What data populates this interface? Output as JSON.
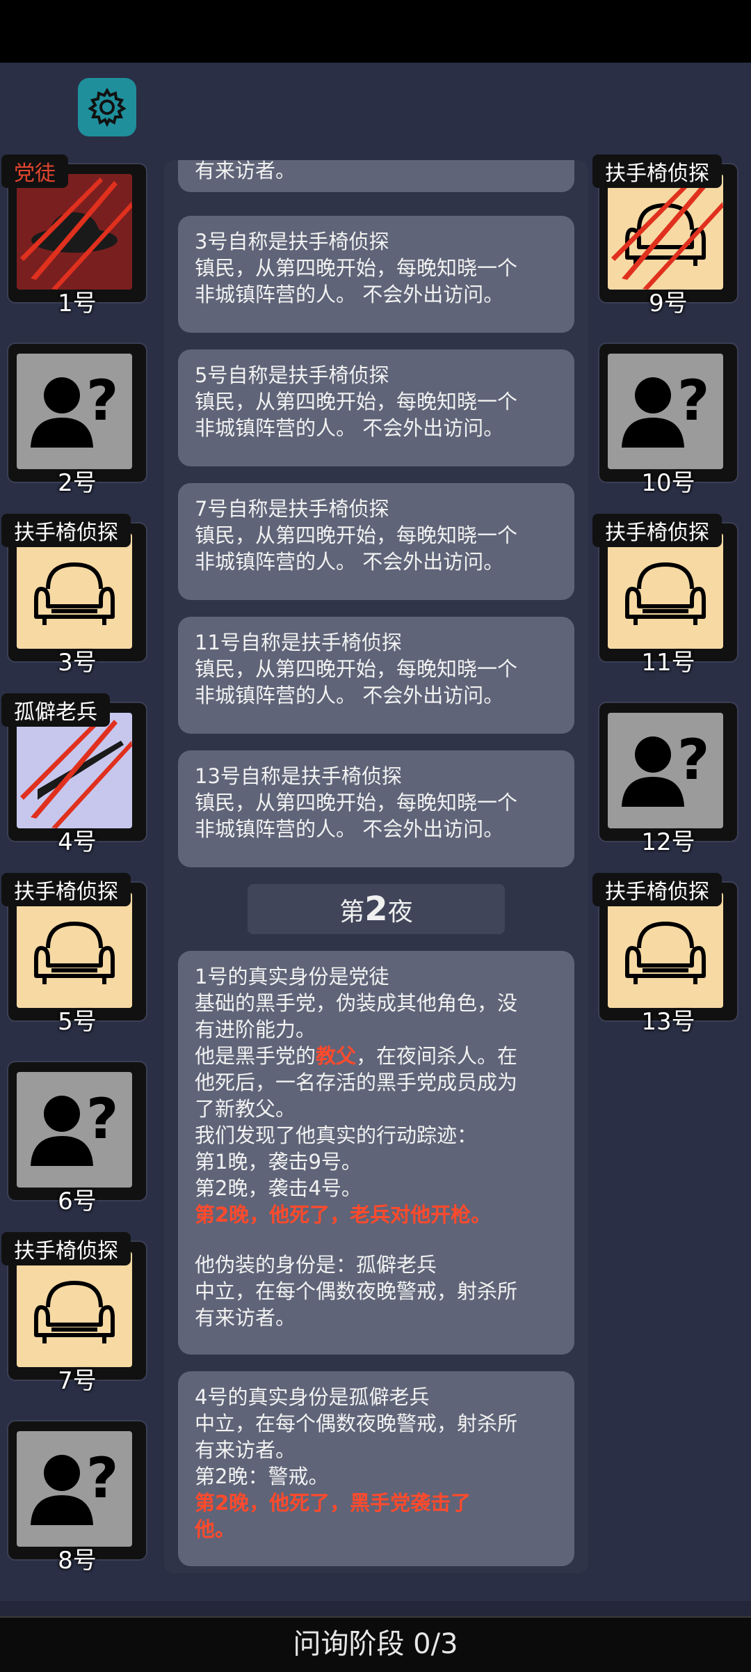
{
  "settings_icon": "gear-icon",
  "players_left": [
    {
      "number": "1号",
      "role": "党徒",
      "role_color": "red",
      "portrait": "mafia"
    },
    {
      "number": "2号",
      "role": "",
      "portrait": "unknown"
    },
    {
      "number": "3号",
      "role": "扶手椅侦探",
      "portrait": "detective"
    },
    {
      "number": "4号",
      "role": "孤僻老兵",
      "portrait": "veteran"
    },
    {
      "number": "5号",
      "role": "扶手椅侦探",
      "portrait": "detective"
    },
    {
      "number": "6号",
      "role": "",
      "portrait": "unknown"
    },
    {
      "number": "7号",
      "role": "扶手椅侦探",
      "portrait": "detective"
    },
    {
      "number": "8号",
      "role": "",
      "portrait": "unknown"
    }
  ],
  "players_right": [
    {
      "number": "9号",
      "role": "扶手椅侦探",
      "portrait": "detective-dead"
    },
    {
      "number": "10号",
      "role": "",
      "portrait": "unknown"
    },
    {
      "number": "11号",
      "role": "扶手椅侦探",
      "portrait": "detective"
    },
    {
      "number": "12号",
      "role": "",
      "portrait": "unknown"
    },
    {
      "number": "13号",
      "role": "扶手椅侦探",
      "portrait": "detective"
    }
  ],
  "log": {
    "top_partial": "有来访者。",
    "claims": [
      {
        "title": "3号自称是扶手椅侦探",
        "desc1": "镇民，从第四晚开始，每晚知晓一个",
        "desc2": "非城镇阵营的人。 不会外出访问。"
      },
      {
        "title": "5号自称是扶手椅侦探",
        "desc1": "镇民，从第四晚开始，每晚知晓一个",
        "desc2": "非城镇阵营的人。 不会外出访问。"
      },
      {
        "title": "7号自称是扶手椅侦探",
        "desc1": "镇民，从第四晚开始，每晚知晓一个",
        "desc2": "非城镇阵营的人。 不会外出访问。"
      },
      {
        "title": "11号自称是扶手椅侦探",
        "desc1": "镇民，从第四晚开始，每晚知晓一个",
        "desc2": "非城镇阵营的人。 不会外出访问。"
      },
      {
        "title": "13号自称是扶手椅侦探",
        "desc1": "镇民，从第四晚开始，每晚知晓一个",
        "desc2": "非城镇阵营的人。 不会外出访问。"
      }
    ],
    "night_prefix": "第",
    "night_number": "2",
    "night_suffix": "夜",
    "reveal1": {
      "l1": "1号的真实身份是党徒",
      "l2": "基础的黑手党，伪装成其他角色，没",
      "l3": "有进阶能力。",
      "l4a": "他是黑手党的",
      "l4b": "教父",
      "l4c": "，在夜间杀人。在",
      "l5": "他死后，一名存活的黑手党成员成为",
      "l6": "了新教父。",
      "l7": "我们发现了他真实的行动踪迹：",
      "l8": "第1晚，袭击9号。",
      "l9": "第2晚，袭击4号。",
      "l10": "第2晚，他死了，老兵对他开枪。",
      "l11": "他伪装的身份是：孤僻老兵",
      "l12": "中立，在每个偶数夜晚警戒，射杀所",
      "l13": "有来访者。"
    },
    "reveal2": {
      "l1": "4号的真实身份是孤僻老兵",
      "l2": "中立，在每个偶数夜晚警戒，射杀所",
      "l3": "有来访者。",
      "l4": "第2晚：警戒。",
      "l5": "第2晚，他死了，黑手党袭击了",
      "l6": "他。"
    }
  },
  "bottom_bar": "问询阶段 0/3",
  "colors": {
    "accent_red": "#ff4a2c",
    "gear_bg": "#1f8f9c",
    "detective_bg": "#f6d9a3",
    "unknown_bg": "#9b9b9b"
  }
}
